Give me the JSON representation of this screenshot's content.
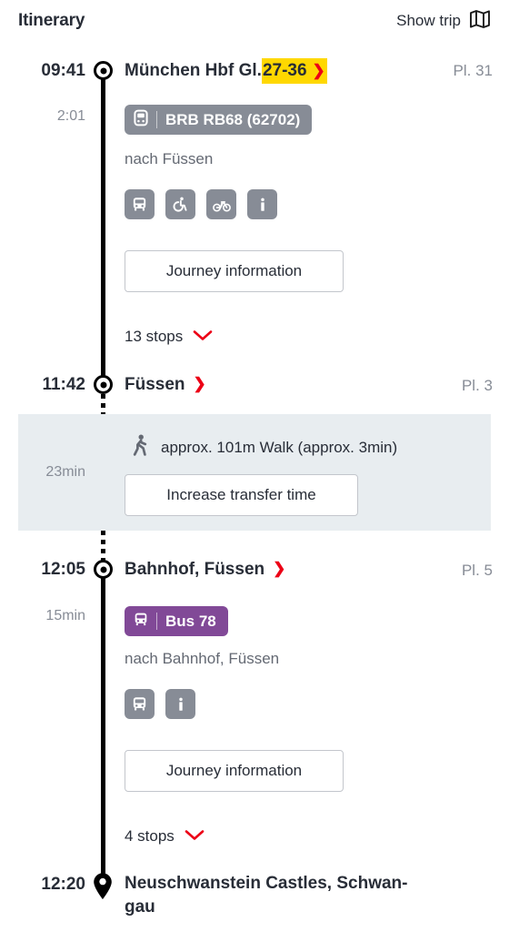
{
  "header": {
    "title": "Itinerary",
    "show_trip_label": "Show trip",
    "map_icon": "map-icon"
  },
  "colors": {
    "accent_red": "#ec0016",
    "highlight_yellow": "#ffd800",
    "train_badge": "#878c96",
    "bus_badge": "#814997",
    "transfer_band": "#e8edf0",
    "muted_text": "#878c96",
    "primary_text": "#282d37"
  },
  "legs": [
    {
      "departure": {
        "time": "09:41",
        "station": "München Hbf Gl.",
        "track_highlight": "27-36",
        "platform": "Pl. 31",
        "marker": "ring-node"
      },
      "duration": "2:01",
      "product": {
        "icon": "train-icon",
        "label": "BRB RB68 (62702)",
        "color": "#878c96"
      },
      "direction": "nach Füssen",
      "amenities": [
        "bus-icon",
        "wheelchair-icon",
        "bicycle-icon",
        "info-icon"
      ],
      "journey_button": "Journey information",
      "stops_toggle": {
        "label": "13 stops",
        "icon": "chevron-down-icon"
      }
    },
    {
      "departure": {
        "time": "12:05",
        "station": "Bahnhof, Füssen",
        "track_highlight": "",
        "platform": "Pl. 5",
        "marker": "ring-node"
      },
      "duration": "15min",
      "product": {
        "icon": "bus-icon",
        "label": "Bus 78",
        "color": "#814997"
      },
      "direction": "nach Bahnhof, Füssen",
      "amenities": [
        "bus-icon",
        "info-icon"
      ],
      "journey_button": "Journey information",
      "stops_toggle": {
        "label": "4 stops",
        "icon": "chevron-down-icon"
      }
    }
  ],
  "arrival_mid": {
    "time": "11:42",
    "station": "Füssen",
    "platform": "Pl. 3",
    "marker": "ring-node"
  },
  "transfer": {
    "duration": "23min",
    "walk_icon": "walking-person-icon",
    "walk_text": "approx. 101m Walk (approx. 3min)",
    "increase_button": "Increase transfer time"
  },
  "arrival_final": {
    "time": "12:20",
    "station": "Neuschwanstein Castles, Schwan-gau",
    "station_line1": "Neuschwanstein Castles, Schwan-",
    "station_line2": "gau",
    "marker": "pin-icon"
  }
}
